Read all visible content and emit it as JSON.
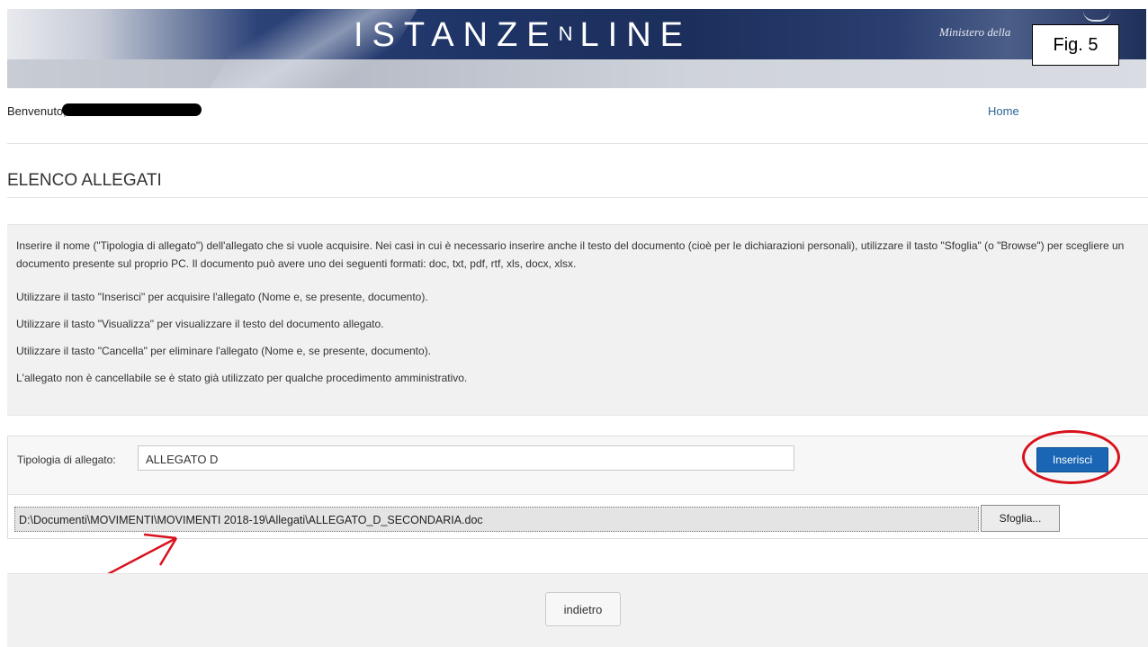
{
  "header": {
    "logo_text_a": "ISTANZ",
    "logo_text_b": "E",
    "logo_text_c": "N",
    "logo_text_d": "LINE",
    "ministry_text": "Ministero della",
    "figure_label": "Fig. 5"
  },
  "topbar": {
    "welcome": "Benvenuto,",
    "home_link": "Home"
  },
  "page": {
    "title": "ELENCO ALLEGATI"
  },
  "info": {
    "paragraph1": "Inserire il nome (\"Tipologia di allegato\") dell'allegato che si vuole acquisire. Nei casi in cui è necessario inserire anche il testo del documento (cioè per le dichiarazioni personali), utilizzare il tasto \"Sfoglia\" (o \"Browse\") per scegliere un documento presente sul proprio PC. Il documento può avere uno dei seguenti formati: doc, txt, pdf, rtf, xls, docx, xlsx.",
    "paragraph2": "Utilizzare il tasto \"Inserisci\" per acquisire l'allegato (Nome e, se presente, documento).",
    "paragraph3": "Utilizzare il tasto \"Visualizza\" per visualizzare il testo del documento allegato.",
    "paragraph4": "Utilizzare il tasto \"Cancella\" per eliminare l'allegato (Nome e, se presente, documento).",
    "paragraph5": "L'allegato non è cancellabile se è stato già utilizzato per qualche procedimento amministrativo."
  },
  "form": {
    "tipologia_label": "Tipologia di allegato:",
    "tipologia_value": "ALLEGATO D",
    "inserisci_label": "Inserisci",
    "file_path": "D:\\Documenti\\MOVIMENTI\\MOVIMENTI 2018-19\\Allegati\\ALLEGATO_D_SECONDARIA.doc",
    "sfoglia_label": "Sfoglia..."
  },
  "footer": {
    "back_label": "indietro"
  },
  "colors": {
    "primary_button": "#1a66b4",
    "annotation_red": "#d8121c",
    "link": "#2a6496"
  }
}
